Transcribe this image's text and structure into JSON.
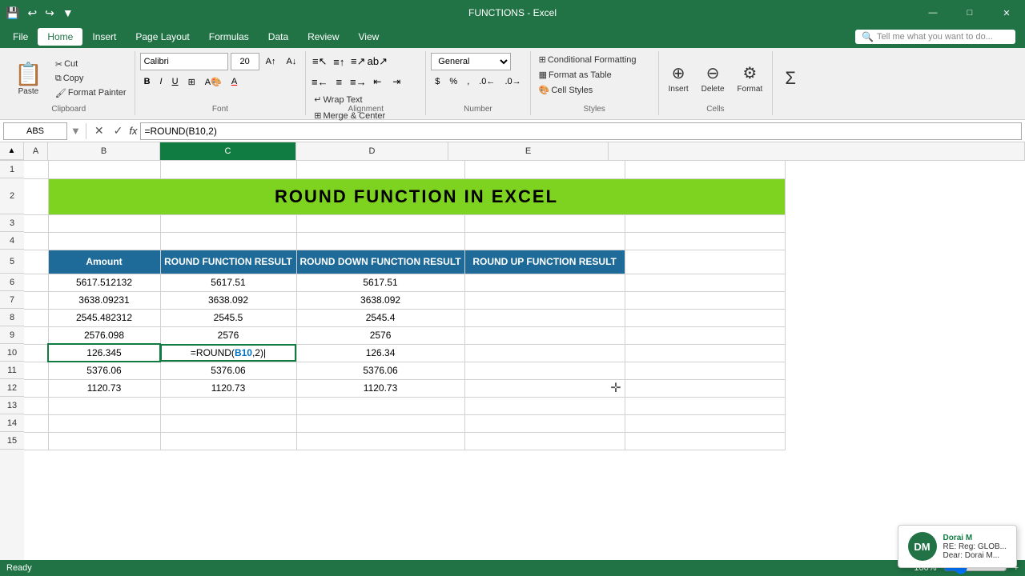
{
  "titleBar": {
    "title": "FUNCTIONS - Excel",
    "windowControls": [
      "—",
      "□",
      "✕"
    ],
    "quickAccessIcons": [
      "💾",
      "↩",
      "↪",
      "🖨",
      "📋",
      "▼"
    ]
  },
  "menuBar": {
    "items": [
      "File",
      "Home",
      "Insert",
      "Page Layout",
      "Formulas",
      "Data",
      "Review",
      "View"
    ],
    "activeItem": "Home",
    "searchPlaceholder": "Tell me what you want to do..."
  },
  "ribbon": {
    "clipboard": {
      "label": "Clipboard",
      "paste_label": "Paste",
      "cut_label": "Cut",
      "copy_label": "Copy",
      "format_painter_label": "Format Painter"
    },
    "font": {
      "label": "Font",
      "font_name": "Calibri",
      "font_size": "20",
      "bold": "B",
      "italic": "I",
      "underline": "U"
    },
    "alignment": {
      "label": "Alignment",
      "wrap_text": "Wrap Text",
      "merge_center": "Merge & Center"
    },
    "number": {
      "label": "Number",
      "format": "General"
    },
    "styles": {
      "label": "Styles",
      "conditional_formatting": "Conditional Formatting",
      "format_as_table": "Format as Table",
      "cell_styles": "Cell Styles"
    },
    "cells": {
      "label": "Cells",
      "insert": "Insert",
      "delete": "Delete",
      "format": "Format"
    }
  },
  "formulaBar": {
    "nameBox": "ABS",
    "formula": "=ROUND(B10,2)"
  },
  "spreadsheet": {
    "columns": [
      "A",
      "B",
      "C",
      "D",
      "E"
    ],
    "selectedColumn": "C",
    "rows": [
      {
        "rowNum": 1,
        "cells": [
          "",
          "",
          "",
          "",
          ""
        ]
      },
      {
        "rowNum": 2,
        "cells": [
          "",
          "ROUND FUNCTION IN EXCEL",
          "",
          "",
          ""
        ]
      },
      {
        "rowNum": 3,
        "cells": [
          "",
          "",
          "",
          "",
          ""
        ]
      },
      {
        "rowNum": 4,
        "cells": [
          "",
          "",
          "",
          "",
          ""
        ]
      },
      {
        "rowNum": 5,
        "cells": [
          "",
          "Amount",
          "ROUND FUNCTION RESULT",
          "ROUND DOWN FUNCTION RESULT",
          "ROUND UP FUNCTION RESULT"
        ]
      },
      {
        "rowNum": 6,
        "cells": [
          "",
          "5617.512132",
          "5617.51",
          "5617.51",
          ""
        ]
      },
      {
        "rowNum": 7,
        "cells": [
          "",
          "3638.09231",
          "3638.092",
          "3638.092",
          ""
        ]
      },
      {
        "rowNum": 8,
        "cells": [
          "",
          "2545.482312",
          "2545.5",
          "2545.4",
          ""
        ]
      },
      {
        "rowNum": 9,
        "cells": [
          "",
          "2576.098",
          "2576",
          "2576",
          ""
        ]
      },
      {
        "rowNum": 10,
        "cells": [
          "",
          "126.345",
          "=ROUND(B10,2)",
          "126.34",
          ""
        ]
      },
      {
        "rowNum": 11,
        "cells": [
          "",
          "5376.06",
          "5376.06",
          "5376.06",
          ""
        ]
      },
      {
        "rowNum": 12,
        "cells": [
          "",
          "1120.73",
          "1120.73",
          "1120.73",
          ""
        ]
      },
      {
        "rowNum": 13,
        "cells": [
          "",
          "",
          "",
          "",
          ""
        ]
      },
      {
        "rowNum": 14,
        "cells": [
          "",
          "",
          "",
          "",
          ""
        ]
      },
      {
        "rowNum": 15,
        "cells": [
          "",
          "",
          "",
          "",
          ""
        ]
      }
    ]
  },
  "notification": {
    "name": "Dorai M",
    "line2": "RE: Reg: GLOB...",
    "line3": "Dear: Dorai M..."
  },
  "statusBar": {
    "items": [
      "Ready"
    ],
    "zoom": "100%",
    "zoomSlider": 100
  }
}
